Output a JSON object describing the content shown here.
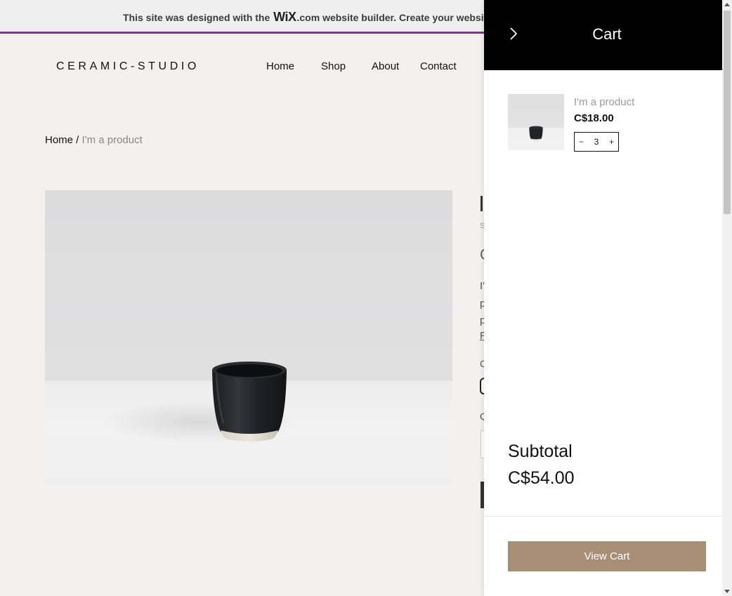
{
  "banner": {
    "text_before": "This site was designed with the ",
    "brand": "WiX",
    "text_after": ".com website builder. Create your website"
  },
  "site": {
    "logo": "CERAMIC-STUDIO",
    "nav": [
      {
        "label": "Home"
      },
      {
        "label": "Shop"
      },
      {
        "label": "About"
      },
      {
        "label": "Contact"
      }
    ]
  },
  "breadcrumb": {
    "home": "Home",
    "separator": " / ",
    "current": "I'm a product"
  },
  "product_peek": {
    "title_initial": "I",
    "sku_initial": "S",
    "price_initial": "C",
    "desc_lines": [
      "I'",
      "p",
      "p"
    ],
    "read_more_initial": "R",
    "color_label_initial": "C",
    "quantity_label_initial": "Q"
  },
  "cart": {
    "title": "Cart",
    "item": {
      "name": "I'm a product",
      "price": "C$18.00",
      "quantity": "3",
      "decrement": "−",
      "increment": "+"
    },
    "subtotal_label": "Subtotal",
    "subtotal_value": "C$54.00",
    "view_cart_label": "View Cart"
  },
  "icons": {
    "close": "chevron-right-icon"
  },
  "colors": {
    "banner_accent": "#8a2c9c",
    "view_cart_button": "#a78f75",
    "cart_header": "#000000"
  }
}
